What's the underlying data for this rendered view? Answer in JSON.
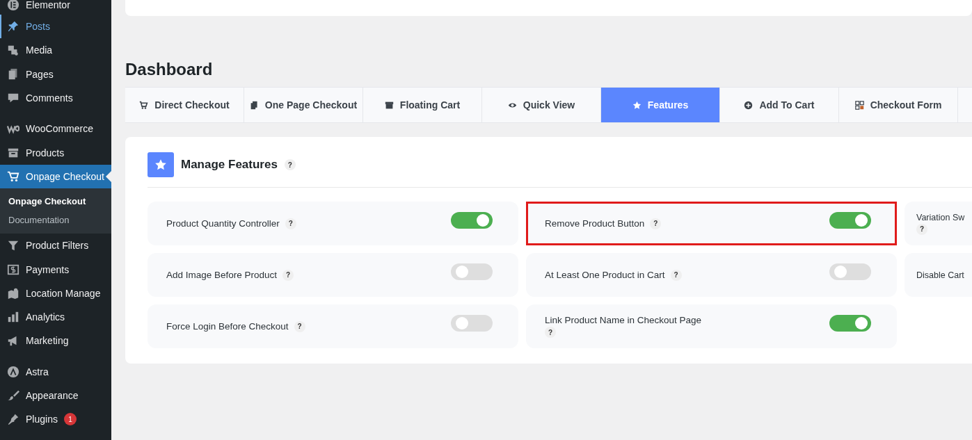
{
  "sidebar": {
    "groups": [
      {
        "items": [
          {
            "label": "Elementor",
            "selected": false,
            "hovered": false
          },
          {
            "label": "Posts",
            "selected": false,
            "hovered": true
          },
          {
            "label": "Media",
            "selected": false,
            "hovered": false
          },
          {
            "label": "Pages",
            "selected": false,
            "hovered": false
          },
          {
            "label": "Comments",
            "selected": false,
            "hovered": false
          }
        ]
      },
      {
        "items": [
          {
            "label": "WooCommerce",
            "selected": false,
            "hovered": false
          },
          {
            "label": "Products",
            "selected": false,
            "hovered": false
          },
          {
            "label": "Onpage Checkout",
            "selected": true,
            "hovered": false,
            "children": [
              {
                "label": "Onpage Checkout",
                "selected": true
              },
              {
                "label": "Documentation",
                "selected": false
              }
            ]
          },
          {
            "label": "Product Filters",
            "selected": false,
            "hovered": false
          },
          {
            "label": "Payments",
            "selected": false,
            "hovered": false
          },
          {
            "label": "Location Manage",
            "selected": false,
            "hovered": false
          },
          {
            "label": "Analytics",
            "selected": false,
            "hovered": false
          },
          {
            "label": "Marketing",
            "selected": false,
            "hovered": false
          }
        ]
      },
      {
        "items": [
          {
            "label": "Astra",
            "selected": false,
            "hovered": false
          },
          {
            "label": "Appearance",
            "selected": false,
            "hovered": false
          },
          {
            "label": "Plugins",
            "selected": false,
            "hovered": false,
            "badge": "1"
          }
        ]
      }
    ]
  },
  "page_title": "Dashboard",
  "tabs": [
    {
      "label": "Direct Checkout",
      "selected": false
    },
    {
      "label": "One Page Checkout",
      "selected": false
    },
    {
      "label": "Floating Cart",
      "selected": false
    },
    {
      "label": "Quick View",
      "selected": false
    },
    {
      "label": "Features",
      "selected": true
    },
    {
      "label": "Add To Cart",
      "selected": false
    },
    {
      "label": "Checkout Form",
      "selected": false
    }
  ],
  "panel": {
    "title": "Manage Features",
    "help": "?",
    "features": [
      {
        "label": "Product Quantity Controller",
        "help": "?",
        "on": true,
        "highlighted": false
      },
      {
        "label": "Remove Product Button",
        "help": "?",
        "on": true,
        "highlighted": true
      },
      {
        "label": "Variation Sw",
        "help": "?",
        "highlighted": false
      },
      {
        "label": "Add Image Before Product",
        "help": "?",
        "on": false,
        "highlighted": false
      },
      {
        "label": "At Least One Product in Cart",
        "help": "?",
        "on": false,
        "highlighted": false
      },
      {
        "label": "Disable Cart",
        "highlighted": false
      },
      {
        "label": "Force Login Before Checkout",
        "help": "?",
        "on": false,
        "highlighted": false
      },
      {
        "label": "Link Product Name in Checkout Page",
        "help": "?",
        "on": true,
        "highlighted": false
      }
    ]
  }
}
